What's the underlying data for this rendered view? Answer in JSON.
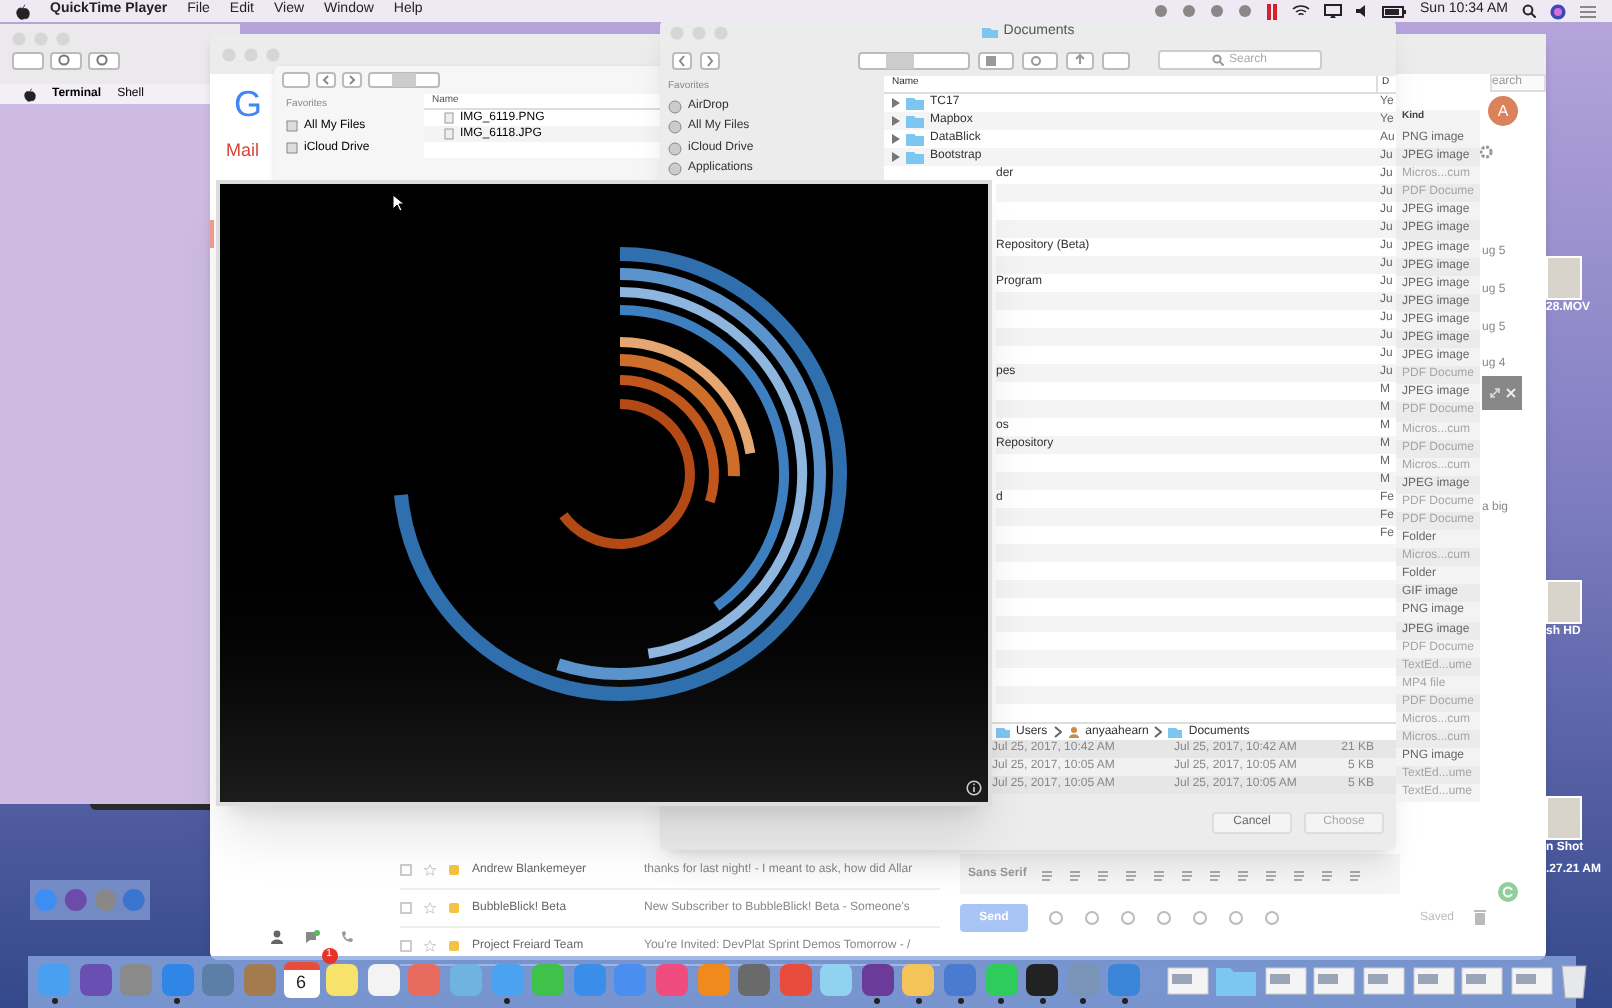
{
  "menubar": {
    "app": "QuickTime Player",
    "menus": [
      "File",
      "Edit",
      "View",
      "Window",
      "Help"
    ],
    "clock": "Sun 10:34 AM"
  },
  "terminal": {
    "menus": [
      "Terminal",
      "Shell"
    ]
  },
  "gmail": {
    "logo": "G",
    "label": "Mail",
    "search_placeholder": "earch",
    "avatar": "A",
    "side_fragments": [
      "ug 5",
      "ug 5",
      "ug 5",
      "ug 4",
      "a big"
    ],
    "emails": [
      {
        "checked": false,
        "sender": "Andrew Blankemeyer",
        "subject": "thanks for last night!",
        "preview": " - I meant to ask, how did Allar"
      },
      {
        "checked": false,
        "sender": "BubbleBlick! Beta",
        "subject": "New Subscriber to BubbleBlick! Beta",
        "preview": " - Someone's"
      },
      {
        "checked": false,
        "sender": "Project Freiard Team",
        "subject": "You're Invited: DevPlat Sprint Demos Tomorrow",
        "preview": " - /"
      }
    ],
    "compose": {
      "font": "Sans Serif",
      "send": "Send",
      "status": "Saved"
    }
  },
  "finder_small": {
    "favorites_heading": "Favorites",
    "favorites": [
      "All My Files",
      "iCloud Drive"
    ],
    "column": "Name",
    "files": [
      "IMG_6119.PNG",
      "IMG_6118.JPG"
    ]
  },
  "documents": {
    "title": "Documents",
    "search_placeholder": "Search",
    "favorites_heading": "Favorites",
    "favorites": [
      "AirDrop",
      "All My Files",
      "iCloud Drive",
      "Applications"
    ],
    "columns": [
      "Name",
      "D"
    ],
    "rows": [
      {
        "kind": "folder",
        "name": "TC17",
        "date": "Ye"
      },
      {
        "kind": "folder",
        "name": "Mapbox",
        "date": "Ye"
      },
      {
        "kind": "folder",
        "name": "DataBlick",
        "date": "Au"
      },
      {
        "kind": "folder",
        "name": "Bootstrap",
        "date": "Ju"
      },
      {
        "kind": "clipped",
        "name": "der",
        "date": "Ju"
      },
      {
        "kind": "clipped",
        "name": "",
        "date": "Ju"
      },
      {
        "kind": "clipped",
        "name": "",
        "date": "Ju"
      },
      {
        "kind": "clipped",
        "name": "",
        "date": "Ju"
      },
      {
        "kind": "clipped",
        "name": "Repository (Beta)",
        "date": "Ju"
      },
      {
        "kind": "clipped",
        "name": "",
        "date": "Ju"
      },
      {
        "kind": "clipped",
        "name": "Program",
        "date": "Ju"
      },
      {
        "kind": "clipped",
        "name": "",
        "date": "Ju"
      },
      {
        "kind": "clipped",
        "name": "",
        "date": "Ju"
      },
      {
        "kind": "clipped",
        "name": "",
        "date": "Ju"
      },
      {
        "kind": "clipped",
        "name": "",
        "date": "Ju"
      },
      {
        "kind": "clipped",
        "name": "pes",
        "date": "Ju"
      },
      {
        "kind": "clipped",
        "name": "",
        "date": "M"
      },
      {
        "kind": "clipped",
        "name": "",
        "date": "M"
      },
      {
        "kind": "clipped",
        "name": "os",
        "date": "M"
      },
      {
        "kind": "clipped",
        "name": "Repository",
        "date": "M"
      },
      {
        "kind": "clipped",
        "name": "",
        "date": "M"
      },
      {
        "kind": "clipped",
        "name": "",
        "date": "M"
      },
      {
        "kind": "clipped",
        "name": "d",
        "date": "Fe"
      },
      {
        "kind": "clipped",
        "name": "",
        "date": "Fe"
      },
      {
        "kind": "clipped",
        "name": "",
        "date": "Fe"
      }
    ],
    "path": [
      "Users",
      "anyaahearn",
      "Documents"
    ]
  },
  "file_rows": [
    {
      "created": "Jul 25, 2017, 10:42 AM",
      "modified": "Jul 25, 2017, 10:42 AM",
      "size": "21 KB"
    },
    {
      "created": "Jul 25, 2017, 10:05 AM",
      "modified": "Jul 25, 2017, 10:05 AM",
      "size": "5 KB"
    },
    {
      "created": "Jul 25, 2017, 10:05 AM",
      "modified": "Jul 25, 2017, 10:05 AM",
      "size": "5 KB"
    }
  ],
  "dialog_buttons": [
    {
      "label": "Cancel",
      "disabled": false
    },
    {
      "label": "Choose",
      "disabled": true
    }
  ],
  "kind_column": {
    "heading": "Kind",
    "items": [
      {
        "text": "PNG image",
        "dim": false
      },
      {
        "text": "JPEG image",
        "dim": false
      },
      {
        "text": "Micros...cum",
        "dim": true
      },
      {
        "text": "PDF Docume",
        "dim": true
      },
      {
        "text": "JPEG image",
        "dim": false
      },
      {
        "text": "JPEG image",
        "dim": false
      },
      {
        "text": "JPEG image",
        "dim": false
      },
      {
        "text": "JPEG image",
        "dim": false
      },
      {
        "text": "JPEG image",
        "dim": false
      },
      {
        "text": "JPEG image",
        "dim": false
      },
      {
        "text": "JPEG image",
        "dim": false
      },
      {
        "text": "JPEG image",
        "dim": false
      },
      {
        "text": "JPEG image",
        "dim": false
      },
      {
        "text": "PDF Docume",
        "dim": true
      },
      {
        "text": "JPEG image",
        "dim": false
      },
      {
        "text": "PDF Docume",
        "dim": true
      },
      {
        "text": "Micros...cum",
        "dim": true
      },
      {
        "text": "PDF Docume",
        "dim": true
      },
      {
        "text": "Micros...cum",
        "dim": true
      },
      {
        "text": "JPEG image",
        "dim": false
      },
      {
        "text": "PDF Docume",
        "dim": true
      },
      {
        "text": "PDF Docume",
        "dim": true
      },
      {
        "text": "Folder",
        "dim": false
      },
      {
        "text": "Micros...cum",
        "dim": true
      },
      {
        "text": "Folder",
        "dim": false
      },
      {
        "text": "GIF image",
        "dim": false
      },
      {
        "text": "PNG image",
        "dim": false
      },
      {
        "text": "JPEG image",
        "dim": false
      },
      {
        "text": "PDF Docume",
        "dim": true
      },
      {
        "text": "TextEd...ume",
        "dim": true
      },
      {
        "text": "MP4 file",
        "dim": true
      },
      {
        "text": "PDF Docume",
        "dim": true
      },
      {
        "text": "Micros...cum",
        "dim": true
      },
      {
        "text": "Micros...cum",
        "dim": true
      },
      {
        "text": "PNG image",
        "dim": false
      },
      {
        "text": "TextEd...ume",
        "dim": true
      },
      {
        "text": "TextEd...ume",
        "dim": true
      }
    ]
  },
  "desktop_icons": [
    "28.MOV",
    "sh HD",
    "n Shot",
    ".27.21 AM"
  ],
  "mini_dock": [
    {
      "kind": "app"
    },
    {
      "kind": "app"
    },
    {
      "kind": "app"
    },
    {
      "kind": "app"
    }
  ],
  "dock": [
    {
      "kind": "app",
      "running": true
    },
    {
      "kind": "app",
      "running": false
    },
    {
      "kind": "app",
      "running": false
    },
    {
      "kind": "app",
      "running": true
    },
    {
      "kind": "app",
      "running": false
    },
    {
      "kind": "app",
      "running": false
    },
    {
      "kind": "calendar",
      "running": false,
      "day": "6",
      "badge": "1"
    },
    {
      "kind": "app",
      "running": false
    },
    {
      "kind": "app",
      "running": false
    },
    {
      "kind": "app",
      "running": false
    },
    {
      "kind": "app",
      "running": false
    },
    {
      "kind": "app",
      "running": true
    },
    {
      "kind": "app",
      "running": false
    },
    {
      "kind": "app",
      "running": false
    },
    {
      "kind": "app",
      "running": false
    },
    {
      "kind": "app",
      "running": false
    },
    {
      "kind": "app",
      "running": false
    },
    {
      "kind": "app",
      "running": false
    },
    {
      "kind": "app",
      "running": false
    },
    {
      "kind": "app",
      "running": false
    },
    {
      "kind": "app",
      "running": true
    },
    {
      "kind": "app",
      "running": true
    },
    {
      "kind": "app",
      "running": true
    },
    {
      "kind": "app",
      "running": true
    },
    {
      "kind": "app",
      "running": true
    },
    {
      "kind": "app",
      "running": true
    },
    {
      "kind": "app",
      "running": true
    },
    {
      "kind": "separator"
    },
    {
      "kind": "document",
      "running": false
    },
    {
      "kind": "folder",
      "running": false
    },
    {
      "kind": "document",
      "running": false
    },
    {
      "kind": "document",
      "running": false
    },
    {
      "kind": "document",
      "running": false
    },
    {
      "kind": "document",
      "running": false
    },
    {
      "kind": "document",
      "running": false
    },
    {
      "kind": "document",
      "running": false
    },
    {
      "kind": "trash",
      "running": false
    }
  ]
}
